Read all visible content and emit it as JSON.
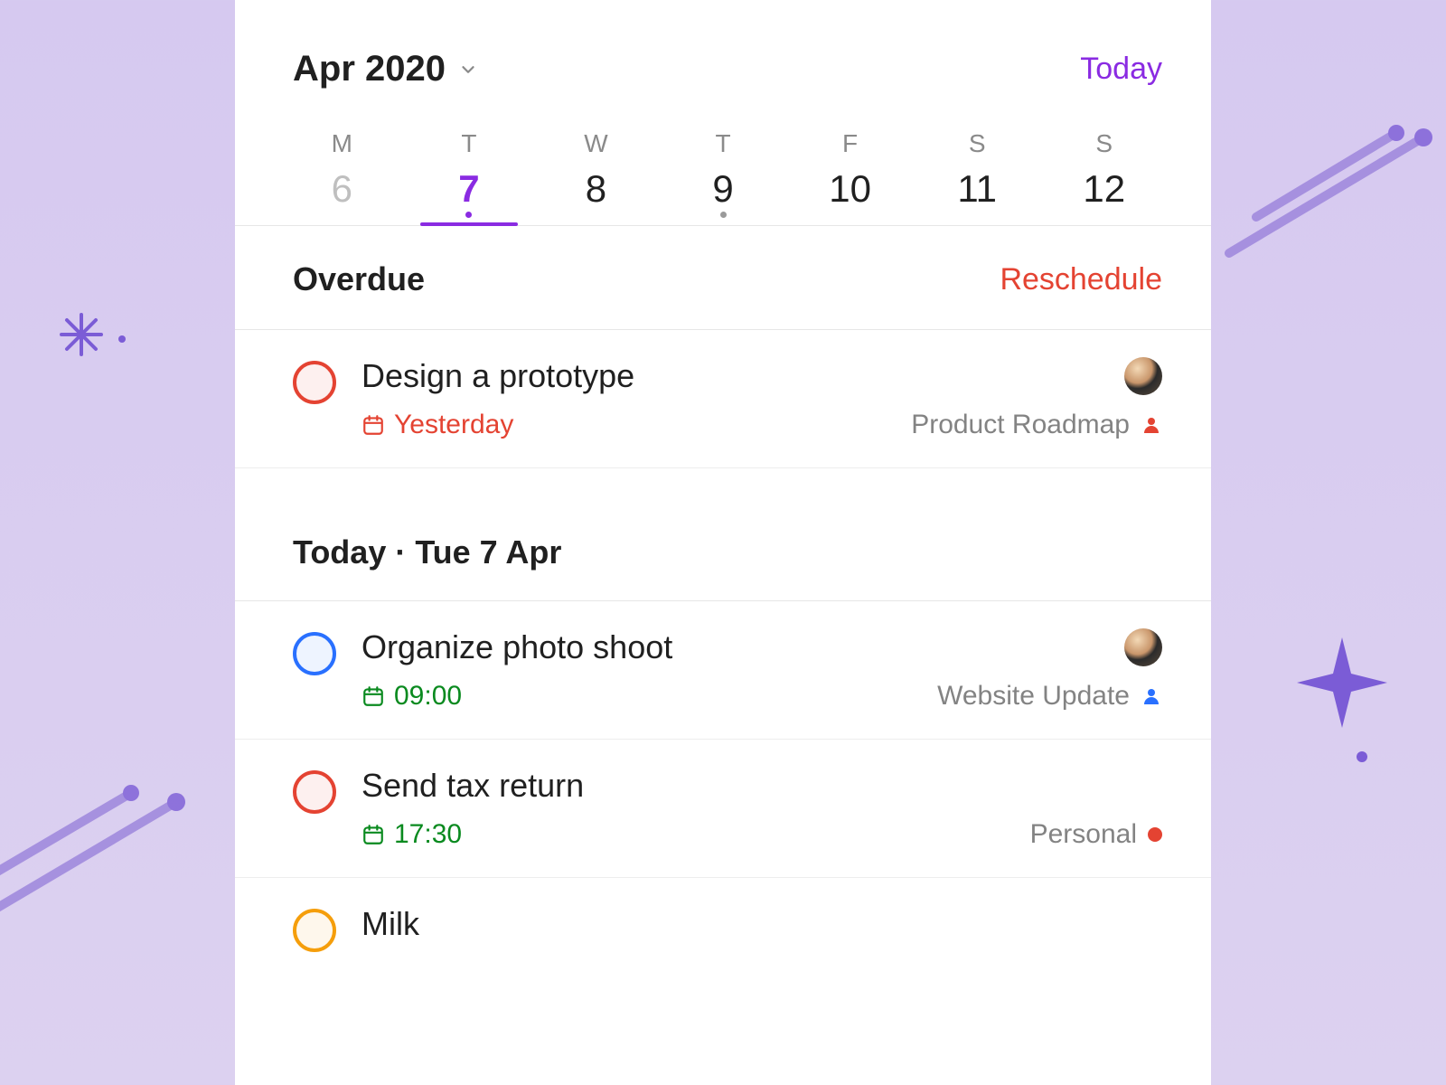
{
  "header": {
    "month_label": "Apr 2020",
    "today_link": "Today"
  },
  "week": [
    {
      "dow": "M",
      "num": "6",
      "state": "muted",
      "dot": null
    },
    {
      "dow": "T",
      "num": "7",
      "state": "selected",
      "dot": "purple"
    },
    {
      "dow": "W",
      "num": "8",
      "state": "normal",
      "dot": null
    },
    {
      "dow": "T",
      "num": "9",
      "state": "normal",
      "dot": "grey"
    },
    {
      "dow": "F",
      "num": "10",
      "state": "normal",
      "dot": null
    },
    {
      "dow": "S",
      "num": "11",
      "state": "normal",
      "dot": null
    },
    {
      "dow": "S",
      "num": "12",
      "state": "normal",
      "dot": null
    }
  ],
  "sections": {
    "overdue": {
      "title": "Overdue",
      "action": "Reschedule"
    },
    "today": {
      "title": "Today · Tue 7 Apr"
    }
  },
  "tasks": {
    "overdue": [
      {
        "title": "Design a prototype",
        "due_label": "Yesterday",
        "due_color": "red",
        "check_color": "red",
        "avatar": true,
        "project_name": "Product Roadmap",
        "project_icon": "person",
        "project_icon_color": "#e44332"
      }
    ],
    "today": [
      {
        "title": "Organize photo shoot",
        "due_label": "09:00",
        "due_color": "green",
        "check_color": "blue",
        "avatar": true,
        "project_name": "Website Update",
        "project_icon": "person",
        "project_icon_color": "#2970ff"
      },
      {
        "title": "Send tax return",
        "due_label": "17:30",
        "due_color": "green",
        "check_color": "red",
        "avatar": false,
        "project_name": "Personal",
        "project_icon": "dot",
        "project_icon_color": "#e44332"
      },
      {
        "title": "Milk",
        "due_label": null,
        "due_color": null,
        "check_color": "orange",
        "avatar": false,
        "project_name": null,
        "project_icon": null,
        "project_icon_color": null
      }
    ]
  },
  "colors": {
    "accent_purple": "#8a2be2",
    "accent_red": "#e44332",
    "accent_blue": "#2970ff",
    "accent_green": "#0a8a1f",
    "accent_orange": "#f59e0b"
  }
}
